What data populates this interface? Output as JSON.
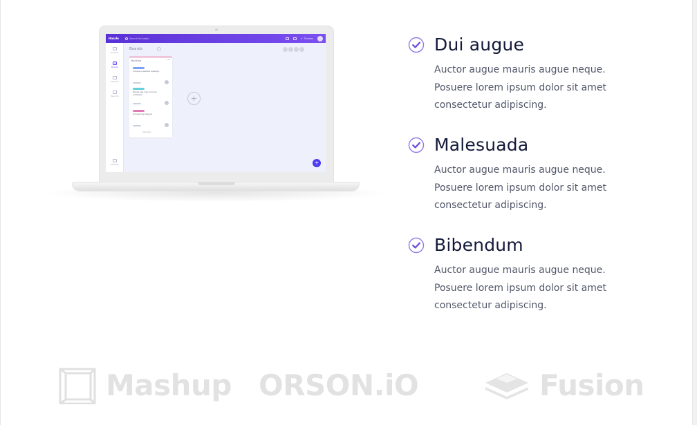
{
  "laptop_app": {
    "brand": "Hassle",
    "search_placeholder": "Search for tasks",
    "team_label": "Themes",
    "sidebar_items": [
      {
        "label": "Projects"
      },
      {
        "label": "Boards"
      },
      {
        "label": "Calendar"
      },
      {
        "label": "Reports"
      },
      {
        "label": "Settings"
      }
    ],
    "boards_title": "Boards",
    "column": {
      "title": "Backlog",
      "cards": [
        {
          "tag_color": "#7aa3f5",
          "text": "Company website redesign."
        },
        {
          "tag_color": "#63d1d9",
          "text": "Mobile app login process prototype"
        },
        {
          "tag_color": "#e07ab4",
          "text": "Onboarding designs"
        }
      ],
      "add_task_label": "Add task"
    },
    "fab_label": "+",
    "add_column_label": "+"
  },
  "features": [
    {
      "title": "Dui augue",
      "description": "Auctor augue mauris augue neque. Posuere lorem ipsum dolor sit amet consectetur adipiscing."
    },
    {
      "title": "Malesuada",
      "description": "Auctor augue mauris augue neque. Posuere lorem ipsum dolor sit amet consectetur adipiscing."
    },
    {
      "title": "Bibendum",
      "description": "Auctor augue mauris augue neque. Posuere lorem ipsum dolor sit amet consectetur adipiscing."
    }
  ],
  "logos": [
    {
      "name": "Mashup",
      "icon": "frame-icon"
    },
    {
      "name": "ORSON.iO",
      "icon": ""
    },
    {
      "name": "Fusion",
      "icon": "layers-icon"
    }
  ],
  "colors": {
    "accent": "#7b5ce6",
    "heading": "#131a3a",
    "body": "#525669",
    "logo_gray": "#e2e2e2",
    "app_bar": "#5a31d6"
  }
}
